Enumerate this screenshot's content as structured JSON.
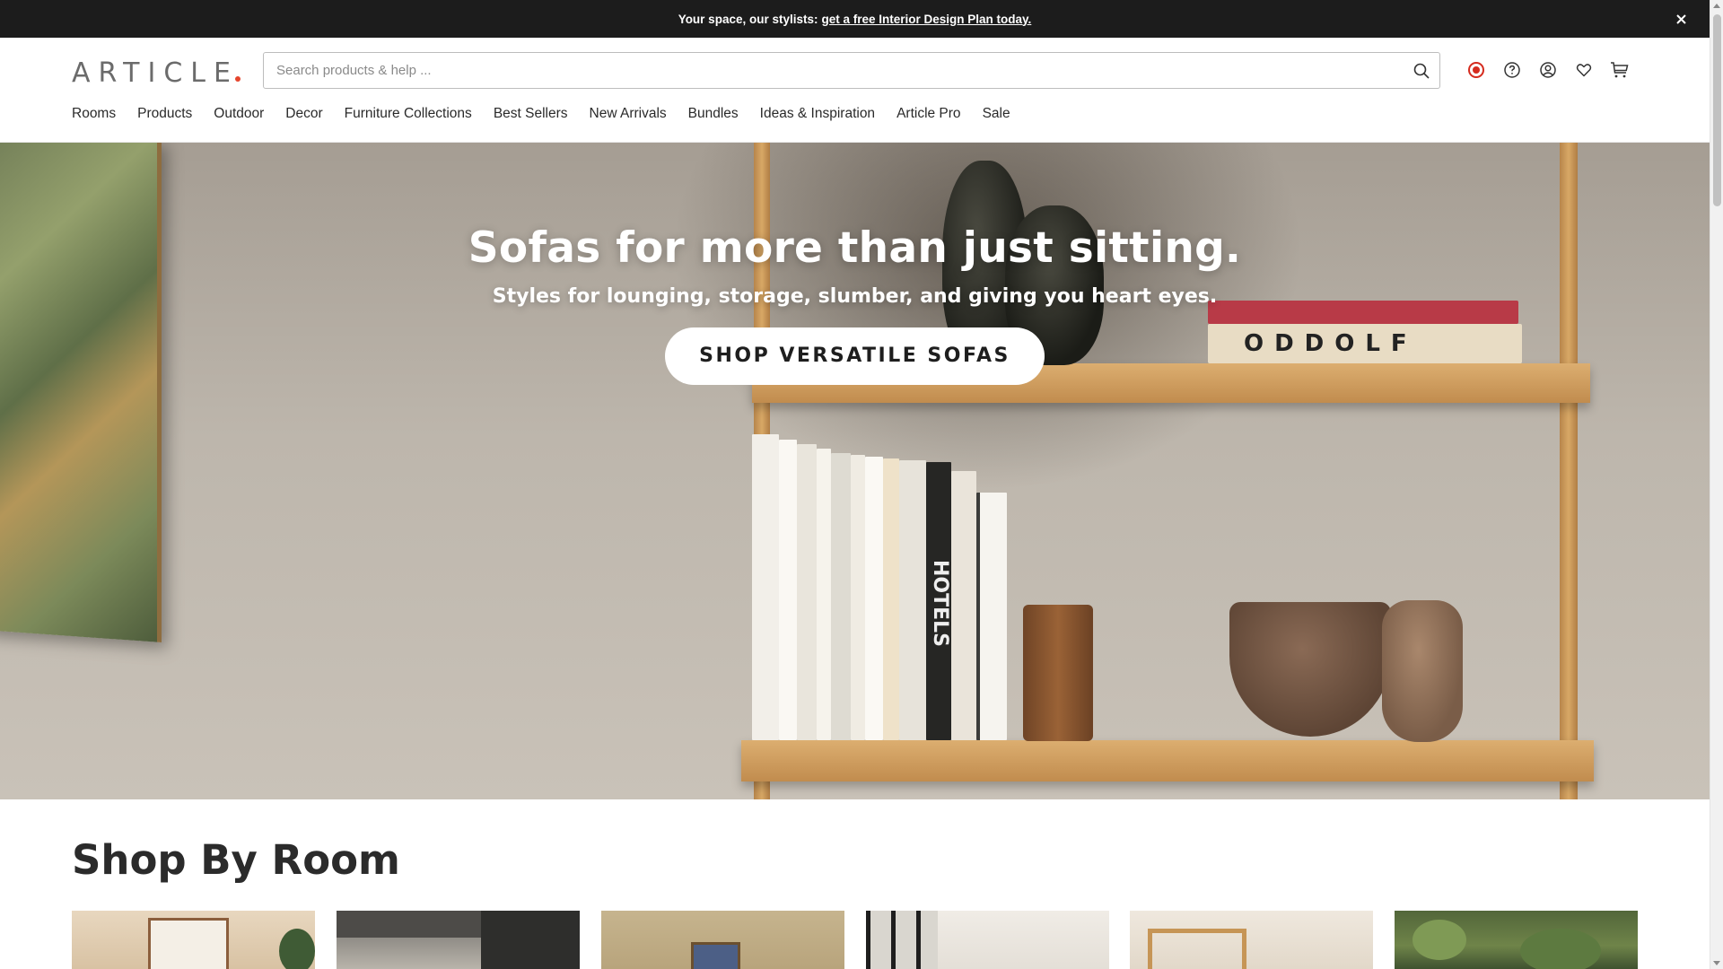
{
  "announcement": {
    "prefix": "Your space, our stylists:",
    "link": "get a free Interior Design Plan today."
  },
  "header": {
    "logo": "ARTICLE",
    "search_placeholder": "Search products & help ..."
  },
  "nav": {
    "items": [
      {
        "label": "Rooms"
      },
      {
        "label": "Products"
      },
      {
        "label": "Outdoor"
      },
      {
        "label": "Decor"
      },
      {
        "label": "Furniture Collections"
      },
      {
        "label": "Best Sellers"
      },
      {
        "label": "New Arrivals"
      },
      {
        "label": "Bundles"
      },
      {
        "label": "Ideas & Inspiration"
      },
      {
        "label": "Article Pro"
      },
      {
        "label": "Sale"
      }
    ]
  },
  "hero": {
    "title": "Sofas for more than just sitting.",
    "subtitle": "Styles for lounging, storage, slumber, and giving you heart eyes.",
    "cta": "SHOP VERSATILE SOFAS",
    "book_text": "HOTELS"
  },
  "shop_by_room": {
    "heading": "Shop By Room"
  },
  "colors": {
    "announcement_bg": "#1c1c1c",
    "logo_dot": "#e5452d",
    "canada_red": "#d52b1e"
  },
  "icons": {
    "search": "search-icon",
    "region": "canada-flag-icon",
    "help": "help-icon",
    "account": "account-icon",
    "wishlist": "heart-icon",
    "cart": "cart-icon",
    "close": "close-icon"
  }
}
